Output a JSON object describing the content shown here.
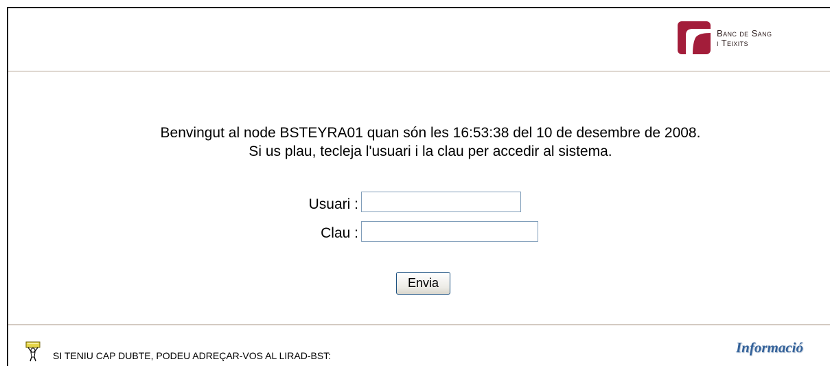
{
  "header": {
    "logo": {
      "line1": "Banc de Sang",
      "line2": "i Teixits",
      "color": "#a31d3a"
    }
  },
  "welcome": {
    "line1": "Benvingut al node BSTEYRA01 quan són les 16:53:38 del 10 de desembre de 2008.",
    "line2": "Si us plau, tecleja l'usuari i la clau per accedir al sistema."
  },
  "form": {
    "user_label": "Usuari :",
    "user_value": "",
    "password_label": "Clau :",
    "password_value": "",
    "submit_label": "Envia"
  },
  "footer": {
    "help_icon": "help-person-icon",
    "help_text": "SI TENIU CAP DUBTE, PODEU ADREÇAR-VOS AL LIRAD-BST:",
    "info_link": "Informació"
  }
}
